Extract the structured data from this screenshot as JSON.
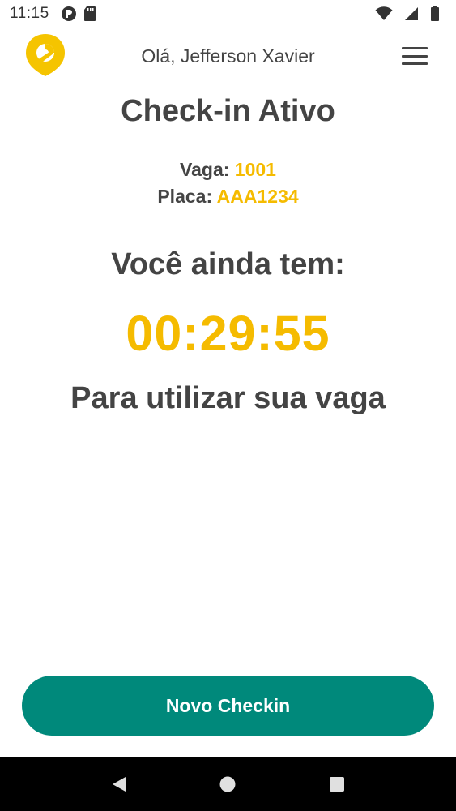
{
  "status_bar": {
    "time": "11:15",
    "icons_left": [
      "mode-icon",
      "sd-card-icon"
    ],
    "icons_right": [
      "wifi-icon",
      "cell-signal-icon",
      "battery-icon"
    ]
  },
  "header": {
    "logo": "parking-pin-logo",
    "greeting": "Olá, Jefferson Xavier",
    "menu_icon": "hamburger-menu-icon"
  },
  "main": {
    "title": "Check-in Ativo",
    "vaga_label": "Vaga:",
    "vaga_value": "1001",
    "placa_label": "Placa:",
    "placa_value": "AAA1234",
    "remaining_label": "Você ainda tem:",
    "timer": "00:29:55",
    "purpose": "Para utilizar sua vaga"
  },
  "actions": {
    "new_checkin_label": "Novo Checkin"
  },
  "nav_bar": {
    "buttons": [
      "back-icon",
      "home-icon",
      "recents-icon"
    ]
  },
  "colors": {
    "accent": "#f5bb00",
    "primary_button": "#00897b",
    "text": "#444444"
  }
}
